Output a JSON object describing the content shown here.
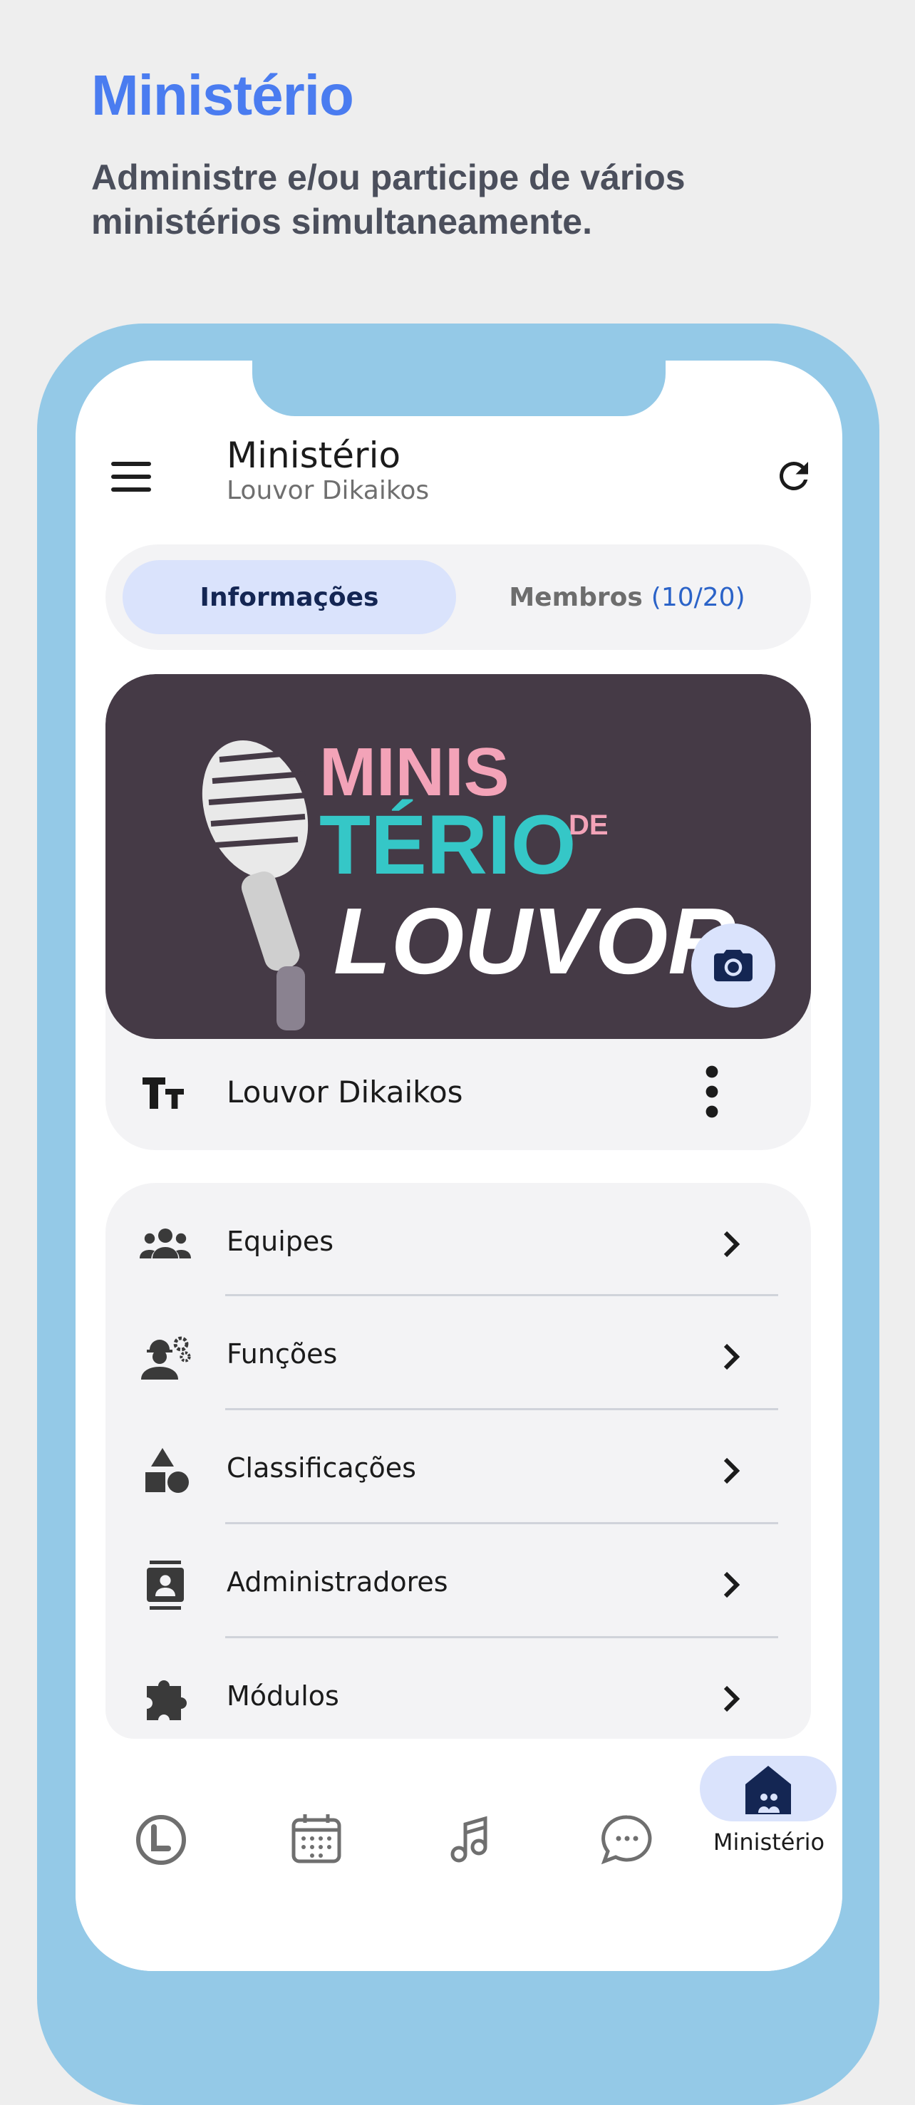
{
  "promo": {
    "title": "Ministério",
    "subtitle": "Administre e/ou participe de vários ministérios simultaneamente."
  },
  "header": {
    "title": "Ministério",
    "subtitle": "Louvor Dikaikos"
  },
  "tabs": {
    "info_label": "Informações",
    "members_label": "Membros",
    "members_count": "(10/20)"
  },
  "card": {
    "banner_line1": "MINIS",
    "banner_line2": "TÉRIO",
    "banner_de": "DE",
    "banner_line3": "LOUVOR",
    "name": "Louvor Dikaikos"
  },
  "menu": {
    "items": [
      {
        "label": "Equipes",
        "icon": "groups-icon"
      },
      {
        "label": "Funções",
        "icon": "engineer-icon"
      },
      {
        "label": "Classificações",
        "icon": "category-icon"
      },
      {
        "label": "Administradores",
        "icon": "contact-card-icon"
      },
      {
        "label": "Módulos",
        "icon": "puzzle-icon"
      }
    ]
  },
  "bottom_nav": {
    "active_label": "Ministério"
  },
  "colors": {
    "accent": "#4a7cf0",
    "frame": "#94c9e7",
    "pill": "#dae3fc",
    "banner_bg": "#453a46",
    "banner_pink": "#f3a3b8",
    "banner_teal": "#35c7c7"
  }
}
